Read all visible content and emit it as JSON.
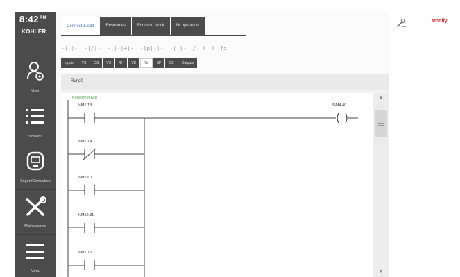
{
  "sidebar": {
    "clock": "8:42",
    "clock_suffix": "PM",
    "logo": "KOHLER",
    "items": [
      {
        "icon": "user-gear-icon",
        "label": "User"
      },
      {
        "icon": "list-icon",
        "label": "Screens"
      },
      {
        "icon": "generator-icon",
        "label": "Ssgen/Contactors"
      },
      {
        "icon": "tools-icon",
        "label": "Maintenance"
      },
      {
        "icon": "menu-icon",
        "label": "Menu"
      }
    ]
  },
  "tabs": [
    {
      "label": "Connect & edit",
      "active": true
    },
    {
      "label": "Resources",
      "active": false
    },
    {
      "label": "Function block",
      "active": false
    },
    {
      "label": "Nr operation",
      "active": false
    }
  ],
  "right_panel": {
    "modify_label": "Modify",
    "tool_icon": "wrench-pen-icon"
  },
  "toolbar": [
    "-|  |-",
    "-|/|-",
    "-||-|+|-",
    "-|p|-|-",
    "-( )-",
    "/",
    "Ⅱ",
    "Ⅱ",
    "fx"
  ],
  "filters": [
    {
      "label": "Inputs",
      "active": false
    },
    {
      "label": "VS",
      "active": false
    },
    {
      "label": "CS",
      "active": false
    },
    {
      "label": "VS",
      "active": false
    },
    {
      "label": "RH",
      "active": false
    },
    {
      "label": "VR",
      "active": false
    },
    {
      "label": "%i",
      "active": true
    },
    {
      "label": "SP",
      "active": false
    },
    {
      "label": "OB",
      "active": false
    },
    {
      "label": "Outputs",
      "active": false
    }
  ],
  "editor": {
    "title": "Rung0",
    "rung_title": "Kohlermot Ecb",
    "contacts": [
      {
        "label": "%M1.18",
        "type": "no"
      },
      {
        "label": "%M1.14",
        "type": "nc"
      },
      {
        "label": "%M19.0",
        "type": "no"
      },
      {
        "label": "%M10.31",
        "type": "no"
      },
      {
        "label": "%M1.12",
        "type": "no"
      }
    ],
    "coil_label": "%M4.40"
  },
  "colors": {
    "sidebar": "#4b4b4b",
    "accent_red": "#d81f26",
    "tab_blue": "#3b73b5",
    "rung_green": "#5aa85a"
  }
}
